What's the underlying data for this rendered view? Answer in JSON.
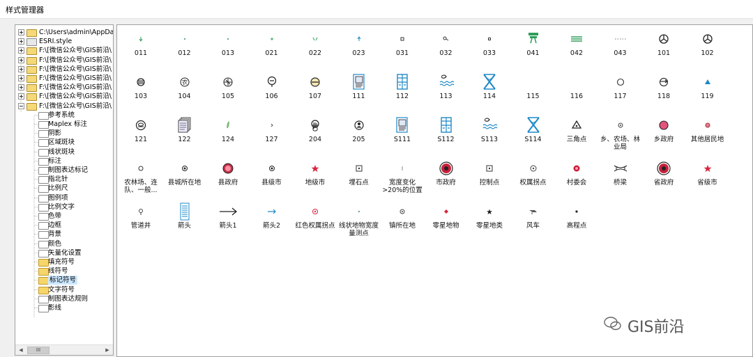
{
  "window": {
    "title": "样式管理器"
  },
  "tree": {
    "roots": [
      {
        "label": "C:\\Users\\admin\\AppData\\",
        "expanded": false
      },
      {
        "label": "ESRI.style",
        "expanded": false
      },
      {
        "label": "F:\\[微信公众号\\GIS前沿\\",
        "expanded": false
      },
      {
        "label": "F:\\[微信公众号\\GIS前沿\\",
        "expanded": false
      },
      {
        "label": "F:\\[微信公众号\\GIS前沿\\",
        "expanded": false
      },
      {
        "label": "F:\\[微信公众号\\GIS前沿\\",
        "expanded": false
      },
      {
        "label": "F:\\[微信公众号\\GIS前沿\\",
        "expanded": false
      },
      {
        "label": "F:\\[微信公众号\\GIS前沿\\",
        "expanded": false
      },
      {
        "label": "F:\\[微信公众号\\GIS前沿\\",
        "expanded": true
      }
    ],
    "children": [
      {
        "label": "参考系统",
        "icon": "doc"
      },
      {
        "label": "Maplex 标注",
        "icon": "doc"
      },
      {
        "label": "阴影",
        "icon": "doc"
      },
      {
        "label": "区域斑块",
        "icon": "doc"
      },
      {
        "label": "线状斑块",
        "icon": "doc"
      },
      {
        "label": "标注",
        "icon": "doc"
      },
      {
        "label": "制图表达标记",
        "icon": "doc"
      },
      {
        "label": "指北针",
        "icon": "doc"
      },
      {
        "label": "比例尺",
        "icon": "doc"
      },
      {
        "label": "图例项",
        "icon": "doc"
      },
      {
        "label": "比例文字",
        "icon": "doc"
      },
      {
        "label": "色带",
        "icon": "doc"
      },
      {
        "label": "边框",
        "icon": "doc"
      },
      {
        "label": "背景",
        "icon": "doc"
      },
      {
        "label": "颜色",
        "icon": "doc"
      },
      {
        "label": "矢量化设置",
        "icon": "doc"
      },
      {
        "label": "填充符号",
        "icon": "yellow"
      },
      {
        "label": "线符号",
        "icon": "yellow"
      },
      {
        "label": "标记符号",
        "icon": "yellow",
        "selected": true
      },
      {
        "label": "文字符号",
        "icon": "yellow"
      },
      {
        "label": "制图表达规则",
        "icon": "doc"
      },
      {
        "label": "影线",
        "icon": "doc"
      }
    ],
    "scroll_thumb": "III"
  },
  "symbols": [
    {
      "label": "011",
      "icon": "small-arrow-down-icon"
    },
    {
      "label": "012",
      "icon": "tiny-dot-icon"
    },
    {
      "label": "013",
      "icon": "tiny-dot-icon"
    },
    {
      "label": "021",
      "icon": "tiny-plus-icon"
    },
    {
      "label": "022",
      "icon": "small-v-icon"
    },
    {
      "label": "023",
      "icon": "small-arrow-up-icon"
    },
    {
      "label": "031",
      "icon": "small-square-icon"
    },
    {
      "label": "032",
      "icon": "small-key-icon"
    },
    {
      "label": "033",
      "icon": "tiny-square-icon"
    },
    {
      "label": "041",
      "icon": "green-sign-icon"
    },
    {
      "label": "042",
      "icon": "green-lines-icon"
    },
    {
      "label": "043",
      "icon": "dotted-line-icon"
    },
    {
      "label": "101",
      "icon": "mercedes-icon"
    },
    {
      "label": "102",
      "icon": "mercedes-icon"
    },
    {
      "label": "103",
      "icon": "circle-hatched-icon"
    },
    {
      "label": "104",
      "icon": "circle-char-icon"
    },
    {
      "label": "105",
      "icon": "airplane-icon"
    },
    {
      "label": "106",
      "icon": "tree-symbol-icon"
    },
    {
      "label": "107",
      "icon": "circle-minus-icon"
    },
    {
      "label": "111",
      "icon": "blue-document-icon"
    },
    {
      "label": "112",
      "icon": "blue-building-icon"
    },
    {
      "label": "113",
      "icon": "blue-wave-icon"
    },
    {
      "label": "114",
      "icon": "blue-cross-icon"
    },
    {
      "label": "115",
      "icon": "none"
    },
    {
      "label": "116",
      "icon": "none"
    },
    {
      "label": "117",
      "icon": "hollow-circle-icon"
    },
    {
      "label": "118",
      "icon": "circle-arrow-icon"
    },
    {
      "label": "119",
      "icon": "blue-triangle-icon"
    },
    {
      "label": "121",
      "icon": "circle-stack-icon"
    },
    {
      "label": "122",
      "icon": "stacked-pages-icon"
    },
    {
      "label": "124",
      "icon": "green-leaf-icon"
    },
    {
      "label": "127",
      "icon": "tiny-mark-icon"
    },
    {
      "label": "204",
      "icon": "hand-icon"
    },
    {
      "label": "205",
      "icon": "circle-person-icon"
    },
    {
      "label": "S111",
      "icon": "blue-document-icon"
    },
    {
      "label": "S112",
      "icon": "blue-building-icon"
    },
    {
      "label": "S113",
      "icon": "blue-wave-icon"
    },
    {
      "label": "S114",
      "icon": "blue-cross-icon"
    },
    {
      "label": "三角点",
      "icon": "triangle-dot-icon"
    },
    {
      "label": "乡、农场、林业局",
      "icon": "circle-dot-small-icon"
    },
    {
      "label": "乡政府",
      "icon": "pink-circle-icon"
    },
    {
      "label": "其他居民地",
      "icon": "small-pink-circle-icon"
    },
    {
      "label": "农林场、连队、一般...",
      "icon": "hollow-small-circle-icon"
    },
    {
      "label": "县城所在地",
      "icon": "double-circle-icon"
    },
    {
      "label": "县政府",
      "icon": "red-ring-icon"
    },
    {
      "label": "县级市",
      "icon": "double-circle-icon"
    },
    {
      "label": "地级市",
      "icon": "red-star-icon"
    },
    {
      "label": "埋石点",
      "icon": "square-dot-icon"
    },
    {
      "label": "宽度变化>20%的位置",
      "icon": "vertical-tick-icon"
    },
    {
      "label": "市政府",
      "icon": "big-red-ring-icon"
    },
    {
      "label": "控制点",
      "icon": "square-dot-icon"
    },
    {
      "label": "权属拐点",
      "icon": "circle-center-dot-icon"
    },
    {
      "label": "村委会",
      "icon": "red-ring-small-icon"
    },
    {
      "label": "桥梁",
      "icon": "bridge-icon"
    },
    {
      "label": "省政府",
      "icon": "big-red-ring-icon"
    },
    {
      "label": "省级市",
      "icon": "red-star-icon"
    },
    {
      "label": "管道井",
      "icon": "pin-icon"
    },
    {
      "label": "箭头",
      "icon": "blue-lined-page-icon"
    },
    {
      "label": "箭头1",
      "icon": "long-arrow-icon"
    },
    {
      "label": "箭头2",
      "icon": "blue-arrow-icon"
    },
    {
      "label": "红色权属拐点",
      "icon": "red-target-icon"
    },
    {
      "label": "线状地物宽度量测点",
      "icon": "tiny-dot-icon"
    },
    {
      "label": "镇所在地",
      "icon": "circle-dot-small-icon"
    },
    {
      "label": "零星地物",
      "icon": "red-diamond-icon"
    },
    {
      "label": "零星地类",
      "icon": "black-star-icon"
    },
    {
      "label": "风车",
      "icon": "windmill-icon"
    },
    {
      "label": "高程点",
      "icon": "black-dot-icon"
    }
  ],
  "watermark": {
    "text": "GIS前沿"
  },
  "colors": {
    "selection": "#cce8ff",
    "accent_blue": "#1e88c8",
    "red": "#d7263d",
    "green": "#2e9e5b"
  }
}
